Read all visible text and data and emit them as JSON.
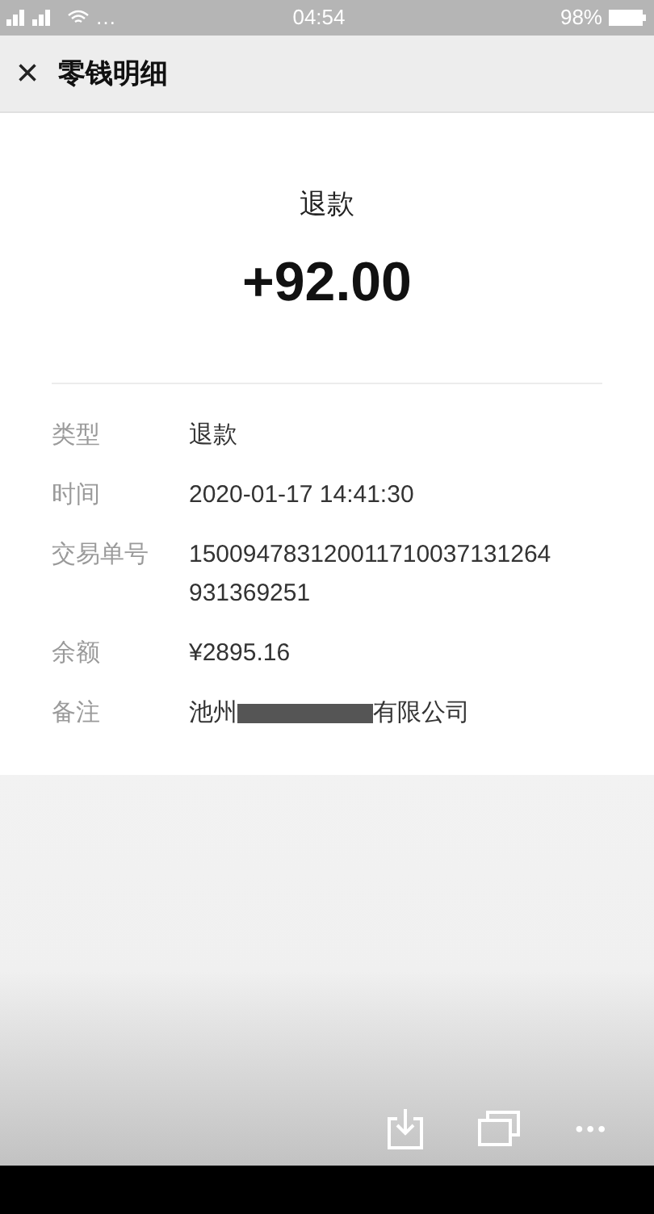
{
  "status_bar": {
    "signal": "…",
    "time": "04:54",
    "battery": "98%"
  },
  "header": {
    "close": "×",
    "title": "零钱明细"
  },
  "summary": {
    "type": "退款",
    "amount": "+92.00"
  },
  "details": [
    {
      "label": "类型",
      "value": "退款"
    },
    {
      "label": "时间",
      "value": "2020-01-17 14:41:30"
    },
    {
      "label": "交易单号",
      "value": "150094783120011710037131264931369251"
    },
    {
      "label": "余额",
      "value": "¥2895.16"
    },
    {
      "label": "备注",
      "kind": "redacted",
      "value": "池州",
      "value_end": "有限公司"
    }
  ],
  "toolbar": {
    "more": "•••"
  }
}
